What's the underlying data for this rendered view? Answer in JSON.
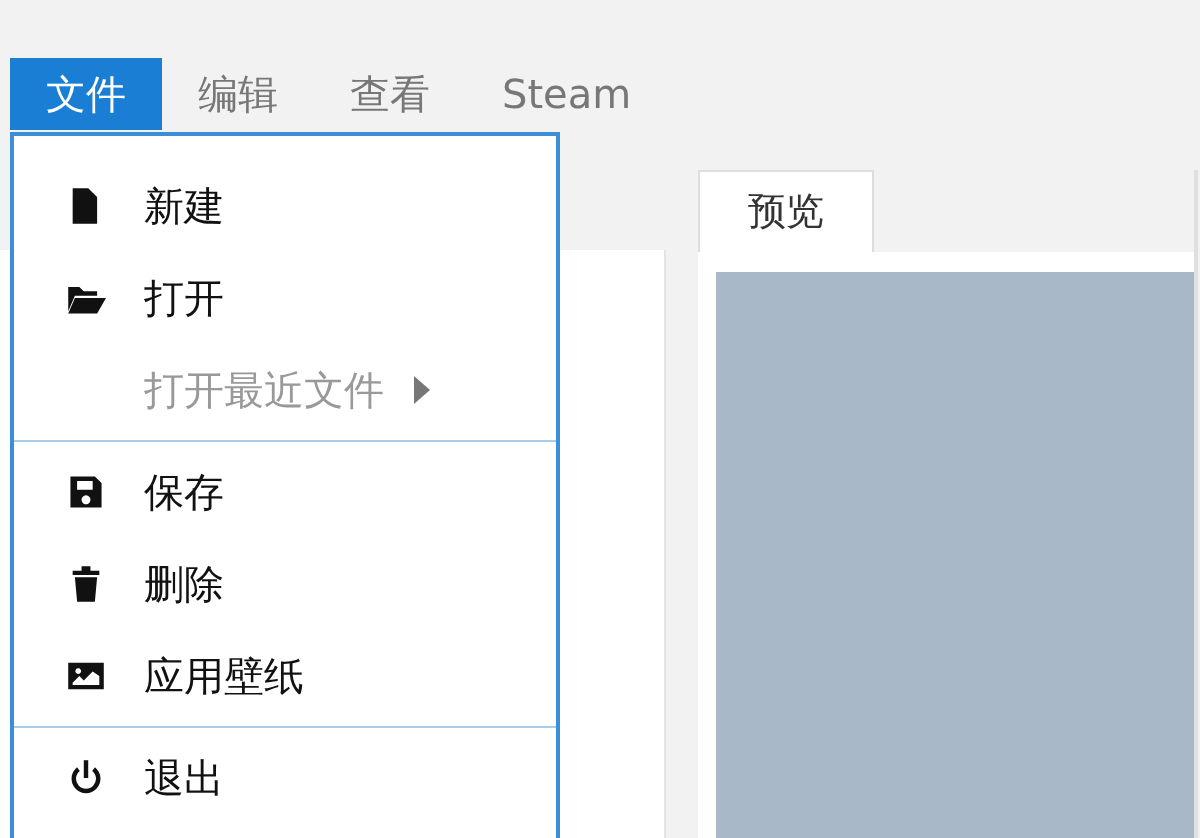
{
  "menu_bar": [
    {
      "label": "文件",
      "selected": true
    },
    {
      "label": "编辑",
      "selected": false
    },
    {
      "label": "查看",
      "selected": false
    },
    {
      "label": "Steam",
      "selected": false
    }
  ],
  "file_menu": [
    {
      "kind": "item",
      "label": "新建",
      "disabled": false
    },
    {
      "kind": "item",
      "label": "打开",
      "disabled": false
    },
    {
      "kind": "submenu",
      "label": "打开最近文件",
      "disabled": true
    },
    {
      "kind": "separator"
    },
    {
      "kind": "item",
      "label": "保存",
      "disabled": false
    },
    {
      "kind": "item",
      "label": "删除",
      "disabled": false
    },
    {
      "kind": "item",
      "label": "应用壁纸",
      "disabled": false
    },
    {
      "kind": "separator"
    },
    {
      "kind": "item",
      "label": "退出",
      "disabled": false
    }
  ],
  "tabs": [
    {
      "label": "预览",
      "selected": true
    }
  ]
}
